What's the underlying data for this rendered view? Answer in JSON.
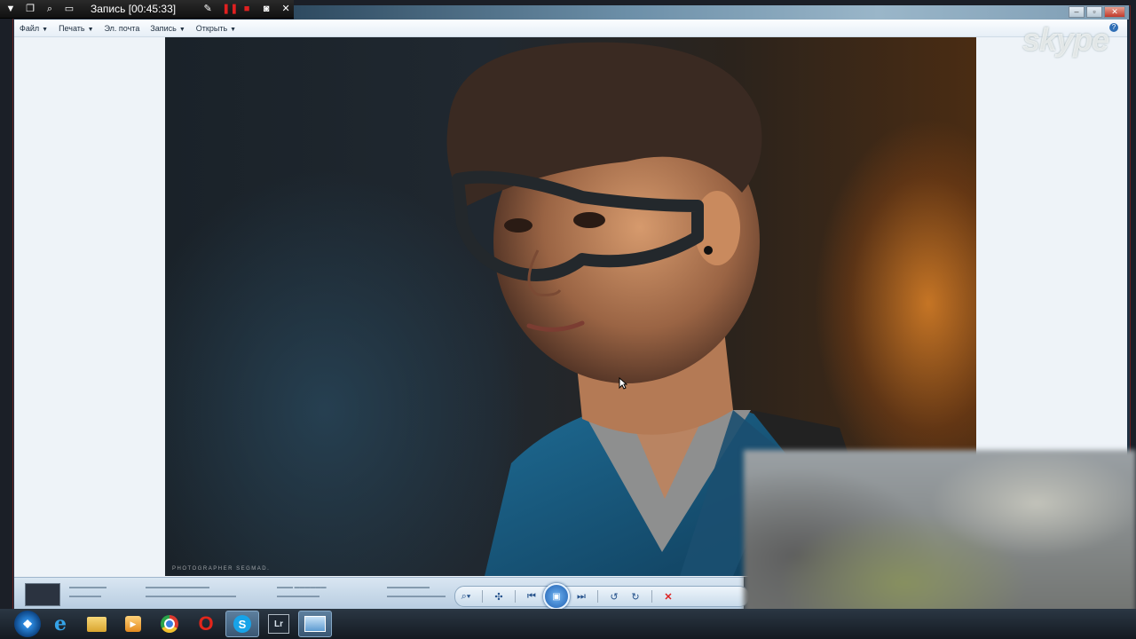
{
  "recorder": {
    "title": "Запись [00:45:33]",
    "icons": [
      "dropdown-arrow-icon",
      "restore-icon",
      "zoom-icon",
      "region-icon",
      "pen-icon",
      "pause-icon",
      "stop-icon",
      "camera-icon",
      "close-icon"
    ]
  },
  "menu": {
    "file": "Файл",
    "print": "Печать",
    "email": "Эл. почта",
    "record": "Запись",
    "open": "Открыть",
    "help": "?"
  },
  "overlay": {
    "skype_logo": "skype"
  },
  "photo": {
    "watermark": "PHOTOGRAPHER SEGMAD."
  },
  "controls": {
    "zoom": "zoom-icon",
    "fit": "fit-icon",
    "previous": "previous-icon",
    "slideshow": "slideshow-icon",
    "next": "next-icon",
    "rotate_ccw": "rotate-ccw-icon",
    "rotate_cw": "rotate-cw-icon",
    "delete": "delete-icon"
  },
  "taskbar": {
    "items": [
      "start",
      "internet-explorer",
      "explorer",
      "media-player",
      "chrome",
      "opera",
      "skype",
      "lightroom",
      "photo-viewer"
    ],
    "lightroom_label": "Lr",
    "skype_letter": "S"
  },
  "colors": {
    "accent": "#2f6fb6",
    "record_red": "#e02020"
  }
}
